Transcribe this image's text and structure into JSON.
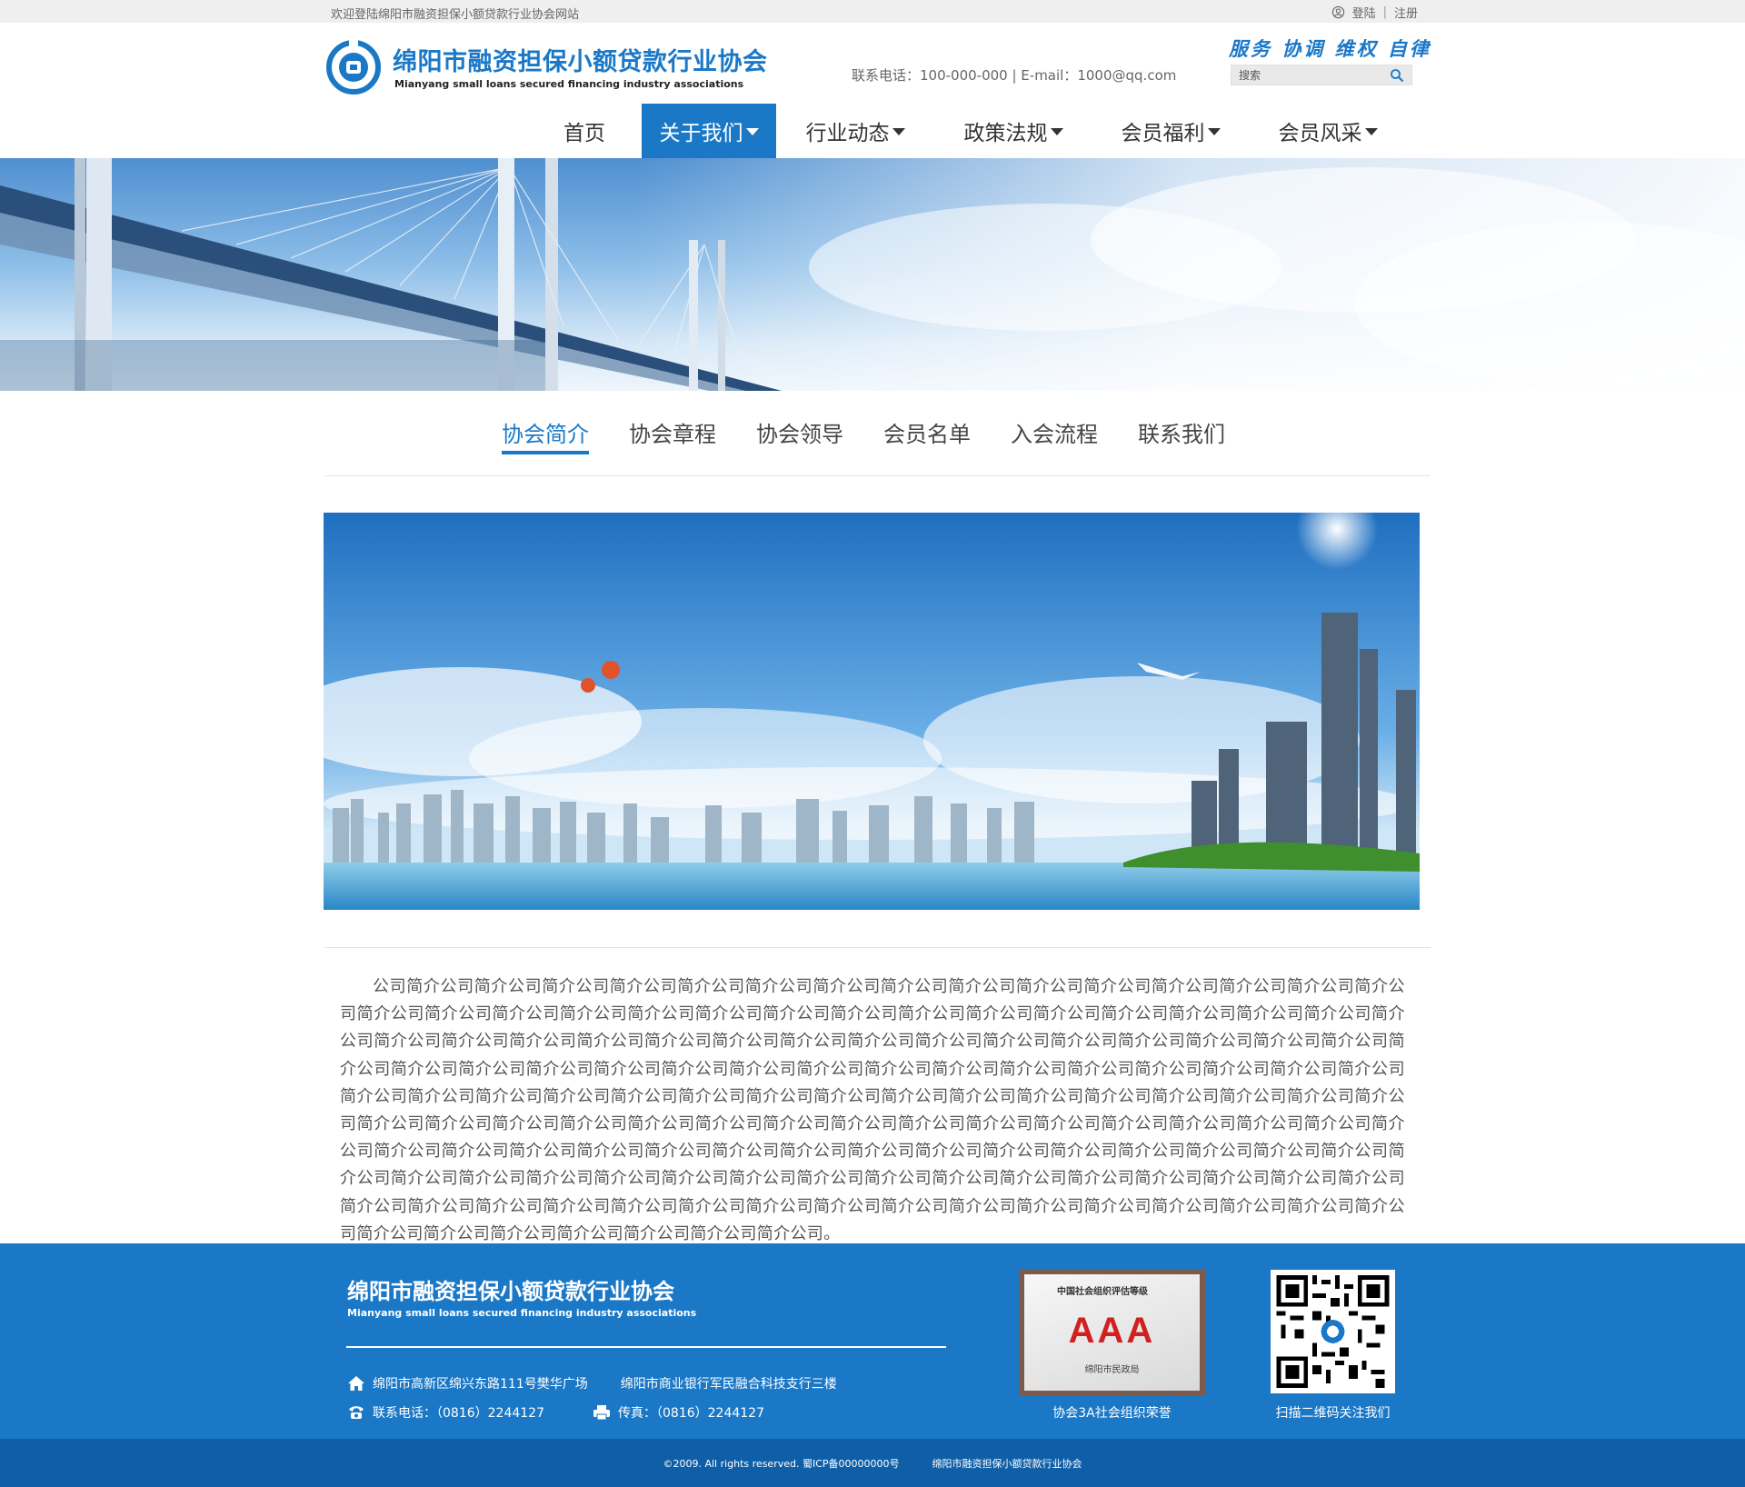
{
  "topbar": {
    "welcome": "欢迎登陆绵阳市融资担保小额贷款行业协会网站",
    "login": "登陆",
    "separator": "|",
    "register": "注册"
  },
  "header": {
    "brand_cn": "绵阳市融资担保小额贷款行业协会",
    "brand_en": "Mianyang small loans secured financing industry associations",
    "contact": "联系电话：100-000-000   |   E-mail：1000@qq.com",
    "slogan": "服务 协调 维权 自律",
    "search_placeholder": "搜索"
  },
  "nav": {
    "items": [
      {
        "label": "首页",
        "caret": false,
        "active": false
      },
      {
        "label": "关于我们",
        "caret": true,
        "active": true
      },
      {
        "label": "行业动态",
        "caret": true,
        "active": false
      },
      {
        "label": "政策法规",
        "caret": true,
        "active": false
      },
      {
        "label": "会员福利",
        "caret": true,
        "active": false
      },
      {
        "label": "会员风采",
        "caret": true,
        "active": false
      }
    ]
  },
  "subtabs": [
    "协会简介",
    "协会章程",
    "协会领导",
    "会员名单",
    "入会流程",
    "联系我们"
  ],
  "article": {
    "text": "公司简介公司简介公司简介公司简介公司简介公司简介公司简介公司简介公司简介公司简介公司简介公司简介公司简介公司简介公司简介公司简介公司简介公司简介公司简介公司简介公司简介公司简介公司简介公司简介公司简介公司简介公司简介公司简介公司简介公司简介公司简介公司简介公司简介公司简介公司简介公司简介公司简介公司简介公司简介公司简介公司简介公司简介公司简介公司简介公司简介公司简介公司简介公司简介公司简介公司简介公司简介公司简介公司简介公司简介公司简介公司简介公司简介公司简介公司简介公司简介公司简介公司简介公司简介公司简介公司简介公司简介公司简介公司简介公司简介公司简介公司简介公司简介公司简介公司简介公司简介公司简介公司简介公司简介公司简介公司简介公司简介公司简介公司简介公司简介公司简介公司简介公司简介公司简介公司简介公司简介公司简介公司简介公司简介公司简介公司简介公司简介公司简介公司简介公司简介公司简介公司简介公司简介公司简介公司简介公司简介公司简介公司简介公司简介公司简介公司简介公司简介公司简介公司简介公司简介公司简介公司简介公司简介公司简介公司简介公司简介公司简介公司简介公司简介公司简介公司简介公司简介公司简介公司简介公司简介公司简介公司简介公司简介公司简介公司简介公司简介公司简介公司简介公司简介公司简介公司简介公司简介公司简介公司简介公司简介公司简介公司简介公司简介公司简介公司。"
  },
  "footer": {
    "brand_cn": "绵阳市融资担保小额贷款行业协会",
    "brand_en": "Mianyang small loans secured financing industry associations",
    "address1": "绵阳市高新区绵兴东路111号樊华广场",
    "address2": "绵阳市商业银行军民融合科技支行三楼",
    "phone": "联系电话：（0816）2244127",
    "fax": "传真：（0816）2244127",
    "award_title": "中国社会组织评估等级",
    "award_grade": "AAA",
    "award_issuer": "绵阳市民政局",
    "award_caption": "协会3A社会组织荣誉",
    "qr_caption": "扫描二维码关注我们",
    "copyright": "©2009. All rights reserved. 蜀ICP备00000000号",
    "copyright_org": "绵阳市融资担保小额贷款行业协会"
  },
  "colors": {
    "brand_blue": "#1a78c7",
    "footer_dark": "#0f5fa8"
  }
}
